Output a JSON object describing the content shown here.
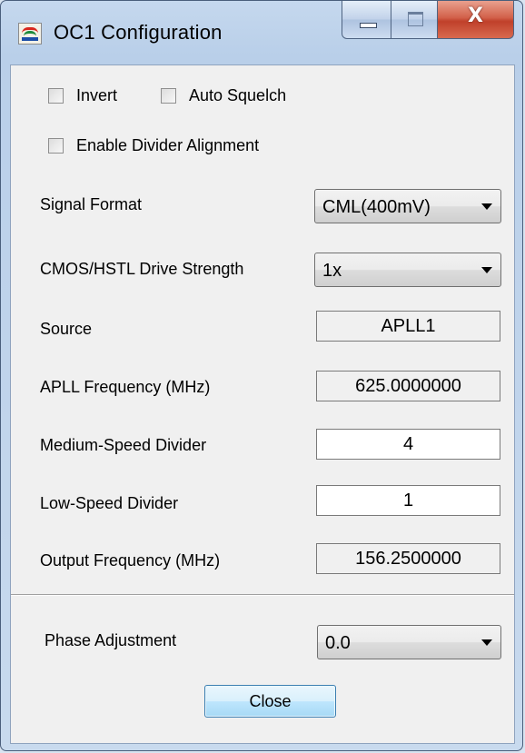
{
  "window": {
    "title": "OC1 Configuration",
    "close_glyph": "X"
  },
  "options": {
    "invert": {
      "label": "Invert",
      "checked": false
    },
    "auto_squelch": {
      "label": "Auto Squelch",
      "checked": false
    },
    "enable_divider_alignment": {
      "label": "Enable Divider Alignment",
      "checked": false
    }
  },
  "signal_format": {
    "label": "Signal Format",
    "value": "CML(400mV)"
  },
  "drive_strength": {
    "label": "CMOS/HSTL Drive Strength",
    "value": "1x"
  },
  "source": {
    "label": "Source",
    "value": "APLL1"
  },
  "apll_frequency": {
    "label": "APLL Frequency (MHz)",
    "value": "625.0000000"
  },
  "medium_speed_divider": {
    "label": "Medium-Speed Divider",
    "value": "4"
  },
  "low_speed_divider": {
    "label": "Low-Speed Divider",
    "value": "1"
  },
  "output_frequency": {
    "label": "Output Frequency (MHz)",
    "value": "156.2500000"
  },
  "phase_adjustment": {
    "label": "Phase Adjustment",
    "value": "0.0"
  },
  "buttons": {
    "close_label": "Close"
  },
  "icons": [
    "app-logo-icon",
    "minimize-icon",
    "maximize-icon",
    "close-icon",
    "dropdown-arrow-icon"
  ],
  "colors": {
    "title_bar": "#b9cfe9",
    "client_bg": "#f0f0f0",
    "close_button": "#c0402a",
    "button_hover": "#bee6fd"
  }
}
